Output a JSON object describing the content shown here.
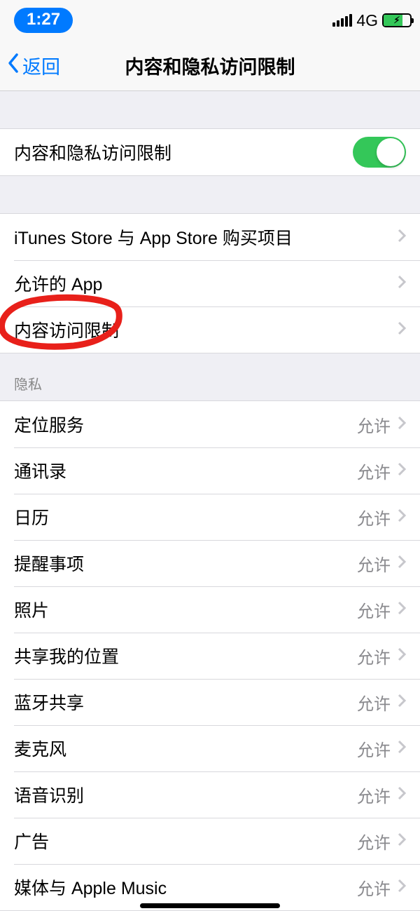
{
  "status": {
    "time": "1:27",
    "network": "4G"
  },
  "nav": {
    "back": "返回",
    "title": "内容和隐私访问限制"
  },
  "toggle_section": {
    "label": "内容和隐私访问限制"
  },
  "content_section": {
    "items": [
      {
        "label": "iTunes Store 与 App Store 购买项目"
      },
      {
        "label": "允许的 App"
      },
      {
        "label": "内容访问限制"
      }
    ]
  },
  "privacy_section": {
    "header": "隐私",
    "items": [
      {
        "label": "定位服务",
        "value": "允许"
      },
      {
        "label": "通讯录",
        "value": "允许"
      },
      {
        "label": "日历",
        "value": "允许"
      },
      {
        "label": "提醒事项",
        "value": "允许"
      },
      {
        "label": "照片",
        "value": "允许"
      },
      {
        "label": "共享我的位置",
        "value": "允许"
      },
      {
        "label": "蓝牙共享",
        "value": "允许"
      },
      {
        "label": "麦克风",
        "value": "允许"
      },
      {
        "label": "语音识别",
        "value": "允许"
      },
      {
        "label": "广告",
        "value": "允许"
      },
      {
        "label": "媒体与 Apple Music",
        "value": "允许"
      }
    ]
  }
}
